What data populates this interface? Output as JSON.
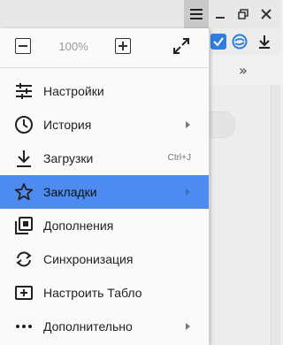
{
  "window": {
    "menu_icon": "hamburger-icon",
    "minimize_icon": "minimize-icon",
    "restore_icon": "restore-icon",
    "close_icon": "close-icon"
  },
  "toolbar": {
    "icons": [
      "checkbox-icon",
      "sync-status-icon",
      "download-icon"
    ],
    "more": "»"
  },
  "menu": {
    "zoom": {
      "value": "100%"
    },
    "items": [
      {
        "label": "Настройки",
        "icon": "settings-sliders-icon"
      },
      {
        "label": "История",
        "icon": "clock-icon",
        "has_submenu": true
      },
      {
        "label": "Загрузки",
        "icon": "download-icon",
        "shortcut": "Ctrl+J"
      },
      {
        "label": "Закладки",
        "icon": "star-icon",
        "has_submenu": true,
        "highlighted": true
      },
      {
        "label": "Дополнения",
        "icon": "extensions-icon"
      },
      {
        "label": "Синхронизация",
        "icon": "sync-icon"
      },
      {
        "label": "Настроить Табло",
        "icon": "dashboard-add-icon"
      },
      {
        "label": "Дополнительно",
        "icon": "more-dots-icon",
        "has_submenu": true
      }
    ]
  },
  "colors": {
    "highlight": "#4d8bf0",
    "accent_blue": "#2f7de1"
  }
}
